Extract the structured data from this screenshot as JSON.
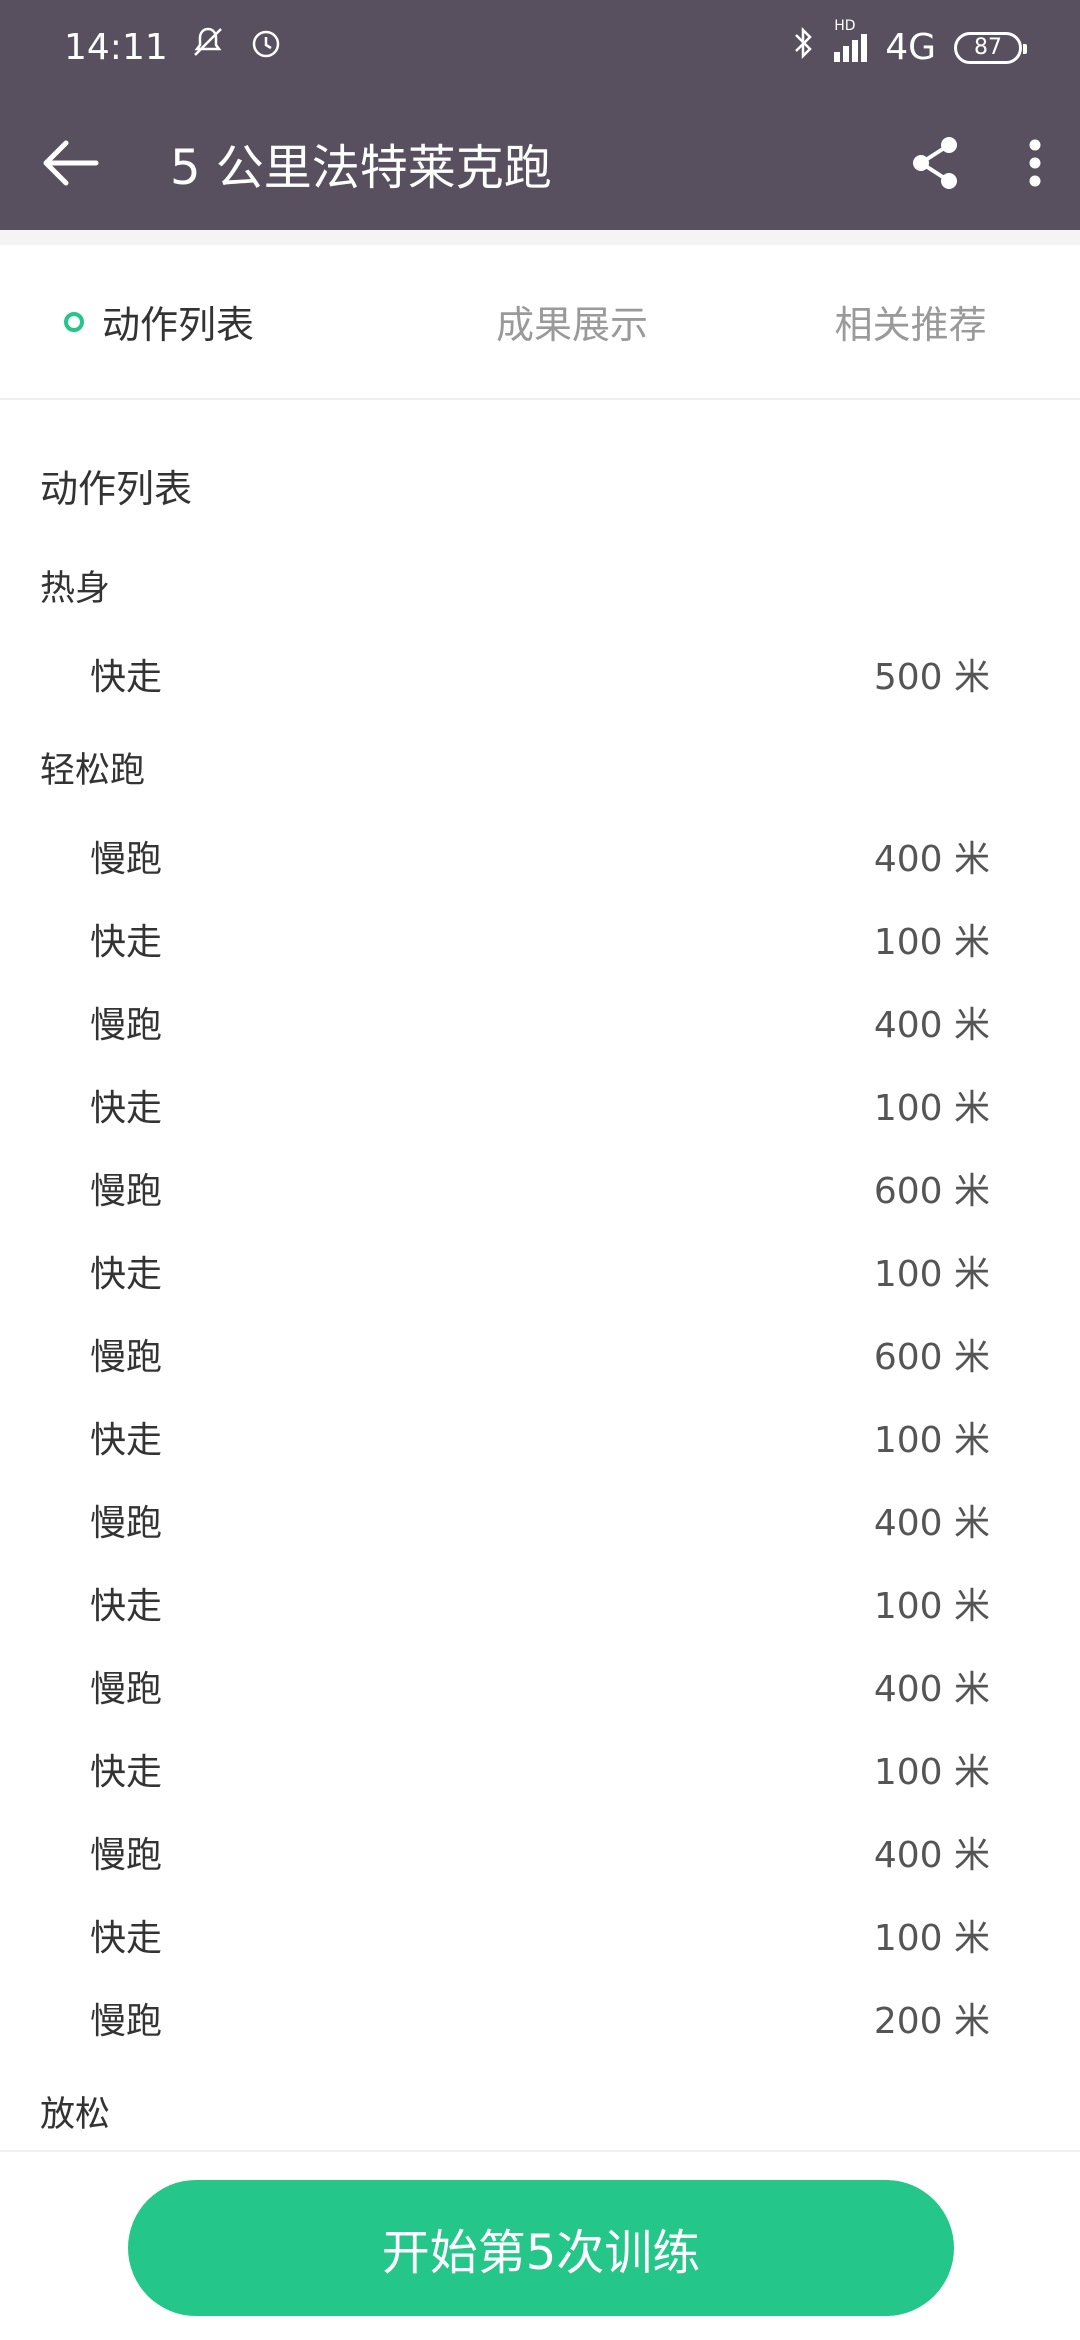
{
  "status_bar": {
    "time": "14:11",
    "network": "4G",
    "battery": "87",
    "hd_label": "HD"
  },
  "app_bar": {
    "title": "5 公里法特莱克跑"
  },
  "tabs": [
    {
      "label": "动作列表",
      "active": true
    },
    {
      "label": "成果展示",
      "active": false
    },
    {
      "label": "相关推荐",
      "active": false
    }
  ],
  "section_title": "动作列表",
  "groups": {
    "warmup": {
      "title": "热身",
      "items": [
        {
          "name": "快走",
          "distance": "500 米"
        }
      ]
    },
    "easy_run": {
      "title": "轻松跑",
      "items": [
        {
          "name": "慢跑",
          "distance": "400 米"
        },
        {
          "name": "快走",
          "distance": "100 米"
        },
        {
          "name": "慢跑",
          "distance": "400 米"
        },
        {
          "name": "快走",
          "distance": "100 米"
        },
        {
          "name": "慢跑",
          "distance": "600 米"
        },
        {
          "name": "快走",
          "distance": "100 米"
        },
        {
          "name": "慢跑",
          "distance": "600 米"
        },
        {
          "name": "快走",
          "distance": "100 米"
        },
        {
          "name": "慢跑",
          "distance": "400 米"
        },
        {
          "name": "快走",
          "distance": "100 米"
        },
        {
          "name": "慢跑",
          "distance": "400 米"
        },
        {
          "name": "快走",
          "distance": "100 米"
        },
        {
          "name": "慢跑",
          "distance": "400 米"
        },
        {
          "name": "快走",
          "distance": "100 米"
        },
        {
          "name": "慢跑",
          "distance": "200 米"
        }
      ]
    },
    "cooldown": {
      "title": "放松"
    }
  },
  "start_button": "开始第5次训练",
  "colors": {
    "header_bg": "#58505f",
    "accent": "#24c789"
  }
}
